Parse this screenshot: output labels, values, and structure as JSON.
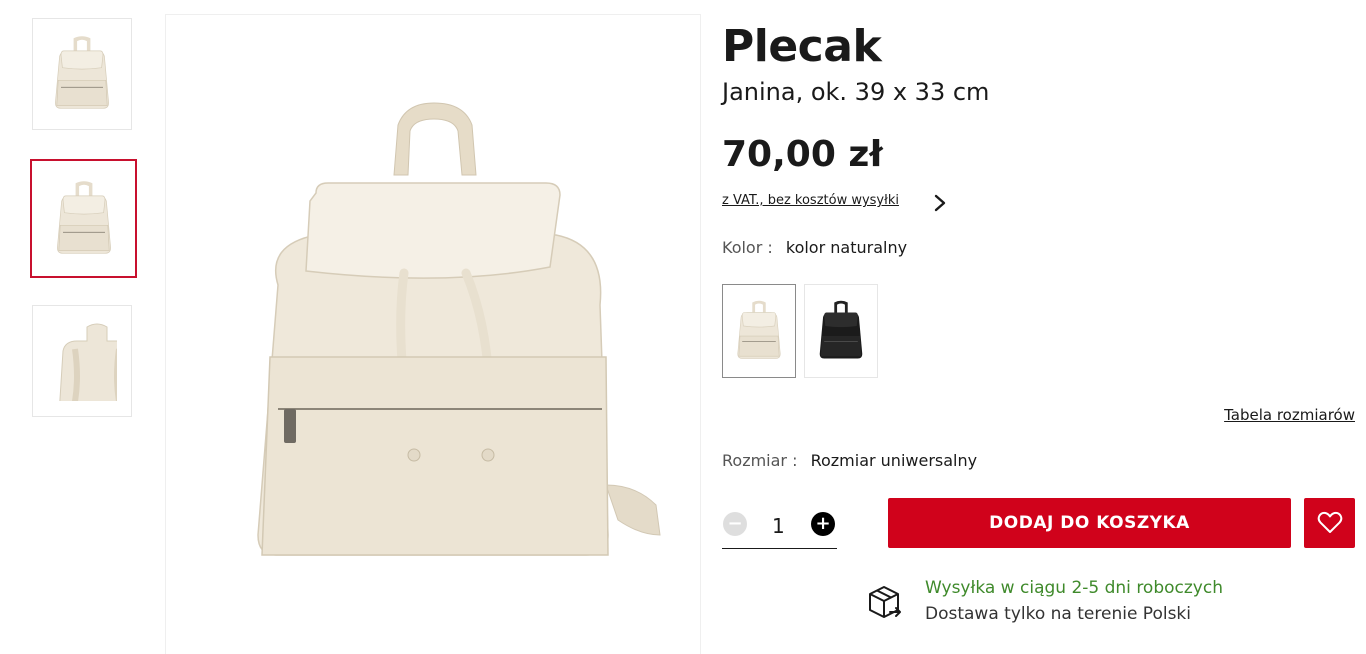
{
  "product": {
    "title": "Plecak",
    "subtitle": "Janina, ok. 39 x 33 cm",
    "price": "70,00 zł",
    "vat_note": "z VAT., bez kosztów wysyłki"
  },
  "color": {
    "label": "Kolor :",
    "value": "kolor naturalny",
    "swatches": [
      "kolor naturalny",
      "czarny"
    ]
  },
  "size": {
    "chart_link": "Tabela rozmiarów",
    "label": "Rozmiar :",
    "value": "Rozmiar uniwersalny"
  },
  "quantity": {
    "value": "1",
    "minus": "−",
    "plus": "+"
  },
  "cart": {
    "add_label": "DODAJ DO KOSZYKA"
  },
  "shipping": {
    "title": "Wysyłka w ciągu 2-5 dni roboczych",
    "subtitle": "Dostawa tylko na terenie Polski"
  },
  "colors": {
    "accent": "#d0021b",
    "active_border": "#c8102e",
    "shipping_green": "#3f8a2b",
    "bag_cream": "#ede6d8"
  },
  "icons": [
    "chevron-right-icon",
    "heart-icon",
    "package-icon"
  ]
}
